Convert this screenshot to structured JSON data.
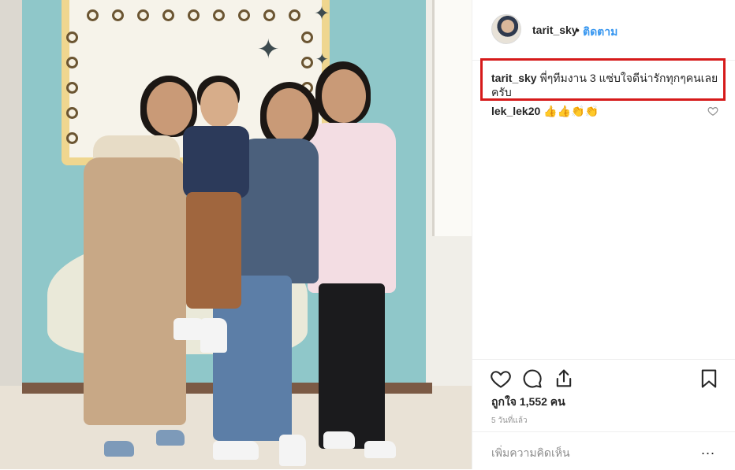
{
  "header": {
    "username": "tarit_sky",
    "separator": "•",
    "follow_label": "ติดตาม"
  },
  "caption": {
    "username": "tarit_sky",
    "text": "พี่ๆทีมงาน 3 แซ่บใจดีน่ารักทุกๆคนเลย ครับ"
  },
  "comments": [
    {
      "username": "lek_lek20",
      "text": "👍👍👏👏"
    }
  ],
  "likes": {
    "label": "ถูกใจ 1,552 คน"
  },
  "timestamp": "5 วันที่แล้ว",
  "add_comment": {
    "placeholder": "เพิ่มความคิดเห็น",
    "more": "..."
  },
  "icons": {
    "like": "heart-icon",
    "comment": "comment-bubble-icon",
    "share": "share-icon",
    "save": "bookmark-icon",
    "comment_like": "heart-small-icon"
  },
  "colors": {
    "follow": "#3897f0",
    "highlight_box": "#d61a1a",
    "muted": "#999999"
  }
}
